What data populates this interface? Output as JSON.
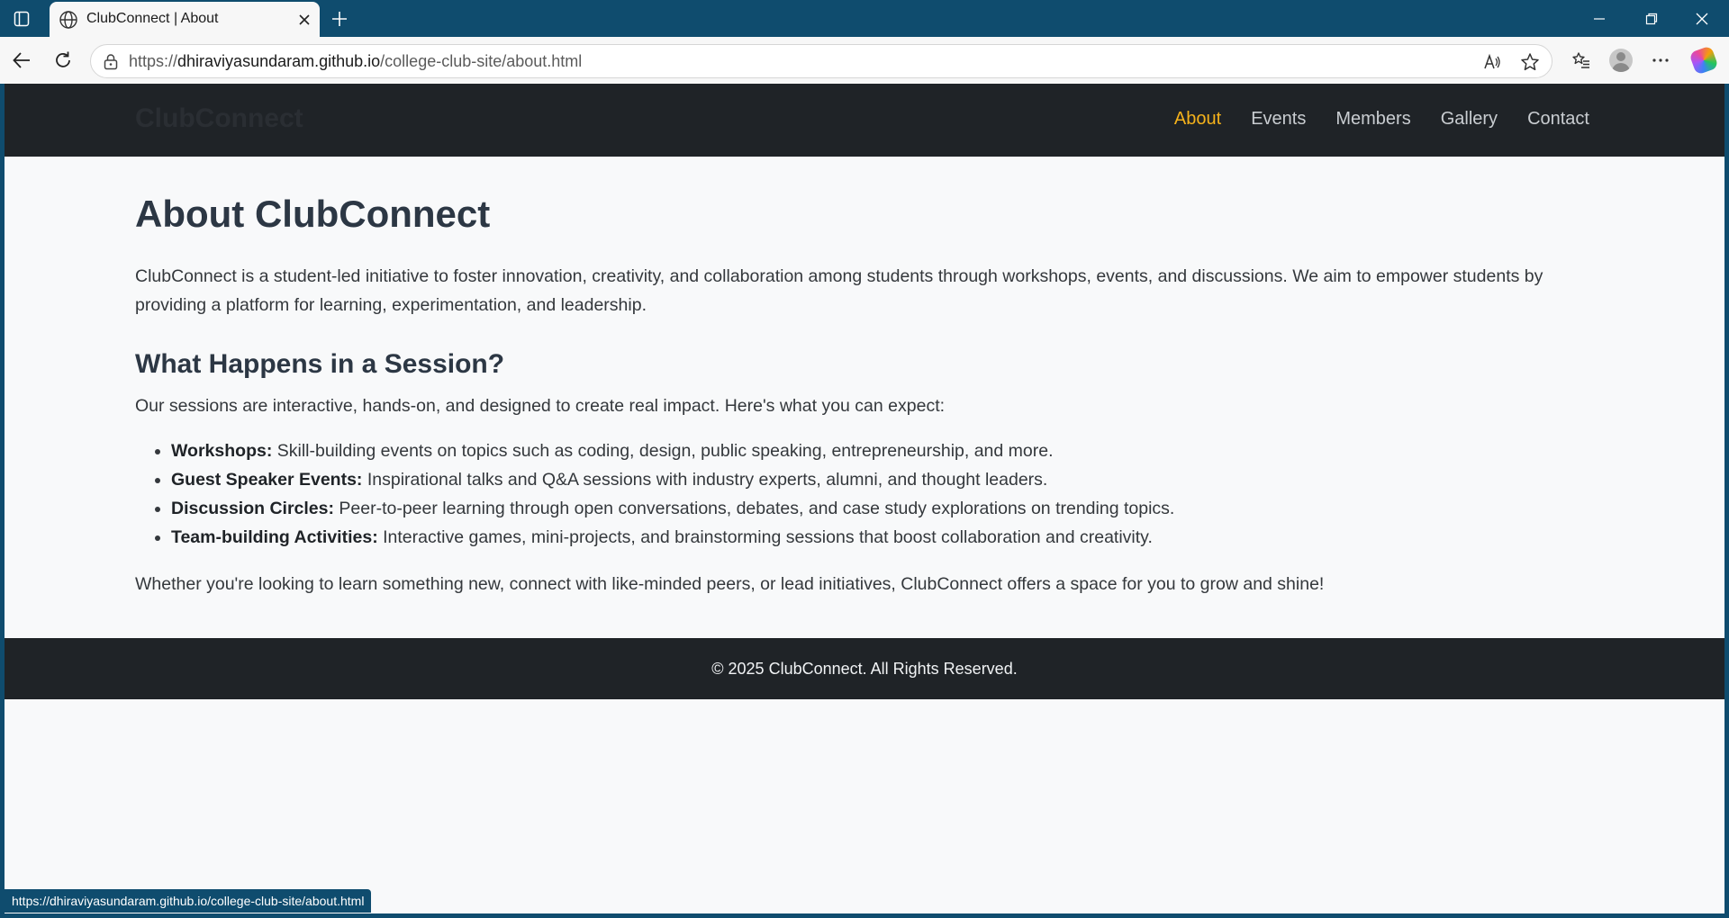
{
  "browser": {
    "tab_title": "ClubConnect | About",
    "url_prefix": "https://",
    "url_host": "dhiraviyasundaram.github.io",
    "url_path": "/college-club-site/about.html",
    "status_url": "https://dhiraviyasundaram.github.io/college-club-site/about.html",
    "icons": [
      "sidebar-icon",
      "globe-icon",
      "close-icon",
      "plus-icon",
      "minimize-icon",
      "restore-icon",
      "close-window-icon",
      "back-icon",
      "refresh-icon",
      "lock-icon",
      "read-aloud-icon",
      "star-icon",
      "favorites-icon",
      "profile-icon",
      "more-icon",
      "copilot-icon"
    ]
  },
  "site": {
    "logo": "ClubConnect",
    "nav": [
      {
        "label": "About",
        "active": true
      },
      {
        "label": "Events",
        "active": false
      },
      {
        "label": "Members",
        "active": false
      },
      {
        "label": "Gallery",
        "active": false
      },
      {
        "label": "Contact",
        "active": false
      }
    ],
    "accent_color": "#f5b21b",
    "header_bg": "#1f2327"
  },
  "main": {
    "title": "About ClubConnect",
    "intro": "ClubConnect is a student-led initiative to foster innovation, creativity, and collaboration among students through workshops, events, and discussions. We aim to empower students by providing a platform for learning, experimentation, and leadership.",
    "section_title": "What Happens in a Session?",
    "section_lead": "Our sessions are interactive, hands-on, and designed to create real impact. Here's what you can expect:",
    "items": [
      {
        "term": "Workshops:",
        "desc": " Skill-building events on topics such as coding, design, public speaking, entrepreneurship, and more."
      },
      {
        "term": "Guest Speaker Events:",
        "desc": " Inspirational talks and Q&A sessions with industry experts, alumni, and thought leaders."
      },
      {
        "term": "Discussion Circles:",
        "desc": " Peer-to-peer learning through open conversations, debates, and case study explorations on trending topics."
      },
      {
        "term": "Team-building Activities:",
        "desc": " Interactive games, mini-projects, and brainstorming sessions that boost collaboration and creativity."
      }
    ],
    "closing": "Whether you're looking to learn something new, connect with like-minded peers, or lead initiatives, ClubConnect offers a space for you to grow and shine!"
  },
  "footer": {
    "text": "© 2025 ClubConnect. All Rights Reserved."
  }
}
